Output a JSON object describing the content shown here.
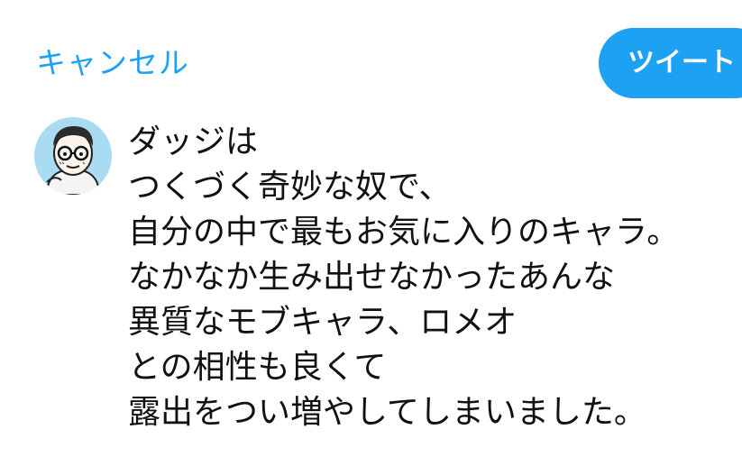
{
  "header": {
    "cancel_label": "キャンセル",
    "tweet_label": "ツイート"
  },
  "composer": {
    "avatar_icon": "avatar-illustration-glasses-man",
    "lines": [
      "ダッジは",
      "つくづく奇妙な奴で、",
      "自分の中で最もお気に入りのキャラ。",
      "なかなか生み出せなかったあんな",
      "異質なモブキャラ、ロメオ",
      "との相性も良くて",
      "露出をつい増やしてしまいました。"
    ]
  },
  "colors": {
    "accent": "#1da1f2",
    "avatar_background": "#a9dcf3",
    "text": "#111111"
  }
}
